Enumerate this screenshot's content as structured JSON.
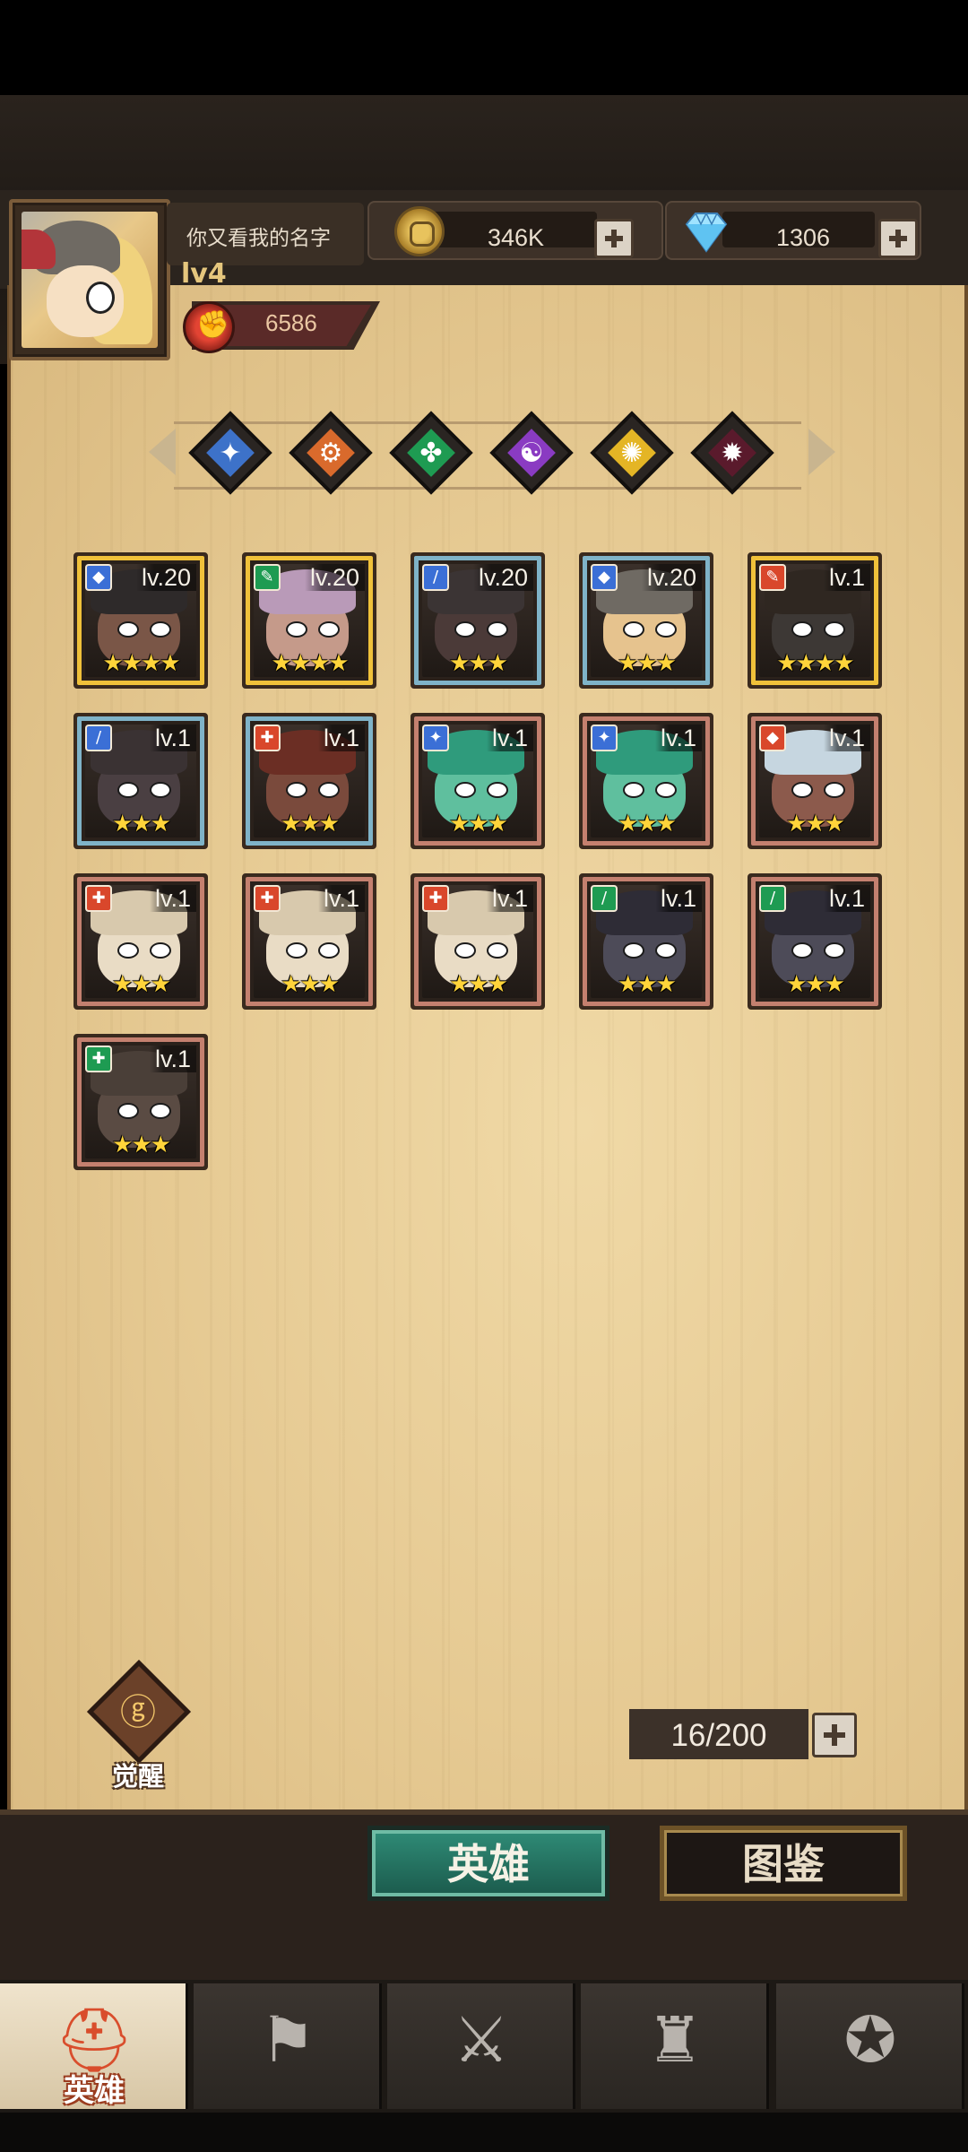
{
  "player": {
    "name": "你又看我的名字",
    "level": "lv4",
    "power": "6586"
  },
  "resources": {
    "gold": "346K",
    "diamonds": "1306"
  },
  "filters": [
    {
      "name": "class-blue",
      "color": "#3d72c9",
      "glyph": "✦"
    },
    {
      "name": "class-orange",
      "color": "#d96a2c",
      "glyph": "⚙"
    },
    {
      "name": "class-green",
      "color": "#1e9b52",
      "glyph": "✤"
    },
    {
      "name": "class-purple",
      "color": "#8a3bc2",
      "glyph": "☯"
    },
    {
      "name": "class-yellow",
      "color": "#e4b525",
      "glyph": "✺"
    },
    {
      "name": "class-dark",
      "color": "#5a1a2c",
      "glyph": "✹"
    }
  ],
  "heroes": [
    {
      "level": "lv.20",
      "stars": "★★★★",
      "rarity": "gold",
      "class_color": "#3b6fd6",
      "class_icon": "◆"
    },
    {
      "level": "lv.20",
      "stars": "★★★★",
      "rarity": "gold",
      "class_color": "#1e9b52",
      "class_icon": "✎"
    },
    {
      "level": "lv.20",
      "stars": "★★★",
      "rarity": "blue",
      "class_color": "#3b6fd6",
      "class_icon": "/"
    },
    {
      "level": "lv.20",
      "stars": "★★★",
      "rarity": "blue",
      "class_color": "#3b6fd6",
      "class_icon": "◆"
    },
    {
      "level": "lv.1",
      "stars": "★★★★",
      "rarity": "gold",
      "class_color": "#d9472b",
      "class_icon": "✎"
    },
    {
      "level": "lv.1",
      "stars": "★★★",
      "rarity": "blue",
      "class_color": "#3b6fd6",
      "class_icon": "/"
    },
    {
      "level": "lv.1",
      "stars": "★★★",
      "rarity": "blue",
      "class_color": "#d9472b",
      "class_icon": "✚"
    },
    {
      "level": "lv.1",
      "stars": "★★★",
      "rarity": "red",
      "class_color": "#3b6fd6",
      "class_icon": "✦"
    },
    {
      "level": "lv.1",
      "stars": "★★★",
      "rarity": "red",
      "class_color": "#3b6fd6",
      "class_icon": "✦"
    },
    {
      "level": "lv.1",
      "stars": "★★★",
      "rarity": "red",
      "class_color": "#d9472b",
      "class_icon": "◆"
    },
    {
      "level": "lv.1",
      "stars": "★★★",
      "rarity": "red",
      "class_color": "#d9472b",
      "class_icon": "✚"
    },
    {
      "level": "lv.1",
      "stars": "★★★",
      "rarity": "red",
      "class_color": "#d9472b",
      "class_icon": "✚"
    },
    {
      "level": "lv.1",
      "stars": "★★★",
      "rarity": "red",
      "class_color": "#d9472b",
      "class_icon": "✚"
    },
    {
      "level": "lv.1",
      "stars": "★★★",
      "rarity": "red",
      "class_color": "#1e9b52",
      "class_icon": "/"
    },
    {
      "level": "lv.1",
      "stars": "★★★",
      "rarity": "red",
      "class_color": "#1e9b52",
      "class_icon": "/"
    },
    {
      "level": "lv.1",
      "stars": "★★★",
      "rarity": "red",
      "class_color": "#1e9b52",
      "class_icon": "✚"
    }
  ],
  "awaken_label": "觉醒",
  "capacity": "16/200",
  "tabs": {
    "heroes": "英雄",
    "codex": "图鉴"
  },
  "nav": [
    {
      "name": "heroes",
      "label": "英雄",
      "icon": "helmet-icon",
      "active": true
    },
    {
      "name": "adventure",
      "label": "",
      "icon": "flag-icon",
      "active": false
    },
    {
      "name": "battle",
      "label": "",
      "icon": "crossed-swords-icon",
      "active": false
    },
    {
      "name": "castle",
      "label": "",
      "icon": "castle-icon",
      "active": false
    },
    {
      "name": "guild",
      "label": "",
      "icon": "guild-emblem-icon",
      "active": false
    }
  ]
}
